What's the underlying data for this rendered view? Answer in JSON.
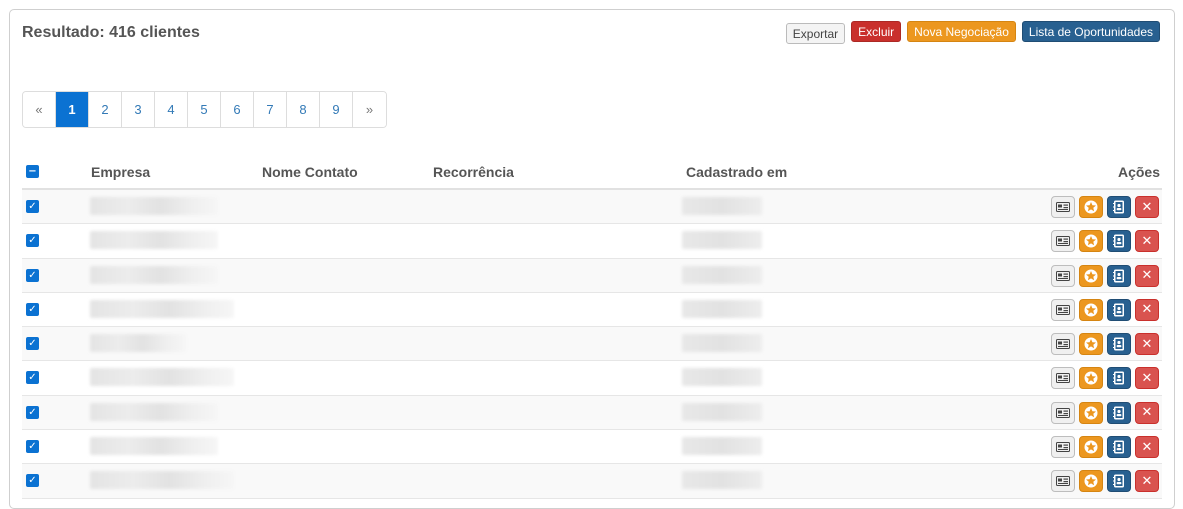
{
  "header": {
    "result_title": "Resultado: 416 clientes",
    "buttons": {
      "exportar": "Exportar",
      "excluir": "Excluir",
      "nova_negociacao": "Nova Negociação",
      "lista_oportunidades": "Lista de Oportunidades"
    }
  },
  "pagination": {
    "prev": "«",
    "next": "»",
    "pages": [
      "1",
      "2",
      "3",
      "4",
      "5",
      "6",
      "7",
      "8",
      "9"
    ],
    "active": "1"
  },
  "table": {
    "columns": {
      "empresa": "Empresa",
      "nome_contato": "Nome Contato",
      "recorrencia": "Recorrência",
      "cadastrado_em": "Cadastrado em",
      "acoes": "Ações"
    },
    "row_count": 9
  },
  "colors": {
    "primary": "#286090",
    "danger": "#d9534f",
    "warning": "#ec971f",
    "active_page": "#0b72d2"
  },
  "icons": {
    "card": "id-card-icon",
    "star": "star-icon",
    "book": "contact-book-icon",
    "delete": "close-icon",
    "check": "checkmark-icon"
  }
}
